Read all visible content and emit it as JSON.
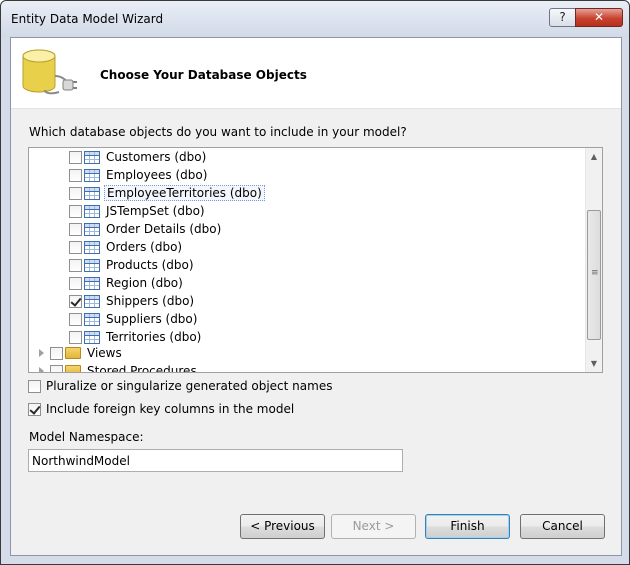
{
  "window": {
    "title": "Entity Data Model Wizard",
    "help_glyph": "?",
    "close_glyph": "✕"
  },
  "header": {
    "title": "Choose Your Database Objects",
    "icon": "database-connection-icon"
  },
  "prompt": "Which database objects do you want to include in your model?",
  "tree": {
    "items": [
      {
        "label": "Customers (dbo)",
        "checked": false,
        "icon": "table-icon"
      },
      {
        "label": "Employees (dbo)",
        "checked": false,
        "icon": "table-icon"
      },
      {
        "label": "EmployeeTerritories (dbo)",
        "checked": false,
        "icon": "table-icon",
        "focused": true
      },
      {
        "label": "JSTempSet (dbo)",
        "checked": false,
        "icon": "table-icon"
      },
      {
        "label": "Order Details (dbo)",
        "checked": false,
        "icon": "table-icon"
      },
      {
        "label": "Orders (dbo)",
        "checked": false,
        "icon": "table-icon"
      },
      {
        "label": "Products (dbo)",
        "checked": false,
        "icon": "table-icon"
      },
      {
        "label": "Region (dbo)",
        "checked": false,
        "icon": "table-icon"
      },
      {
        "label": "Shippers (dbo)",
        "checked": true,
        "icon": "table-icon"
      },
      {
        "label": "Suppliers (dbo)",
        "checked": false,
        "icon": "table-icon"
      },
      {
        "label": "Territories (dbo)",
        "checked": false,
        "icon": "table-icon"
      }
    ],
    "views_label": "Views",
    "stored_label": "Stored Procedures"
  },
  "options": {
    "pluralize_label": "Pluralize or singularize generated object names",
    "pluralize_checked": false,
    "fk_label": "Include foreign key columns in the model",
    "fk_checked": true
  },
  "namespace": {
    "label": "Model Namespace:",
    "value": "NorthwindModel"
  },
  "buttons": {
    "previous": "< Previous",
    "next": "Next >",
    "finish": "Finish",
    "cancel": "Cancel"
  }
}
